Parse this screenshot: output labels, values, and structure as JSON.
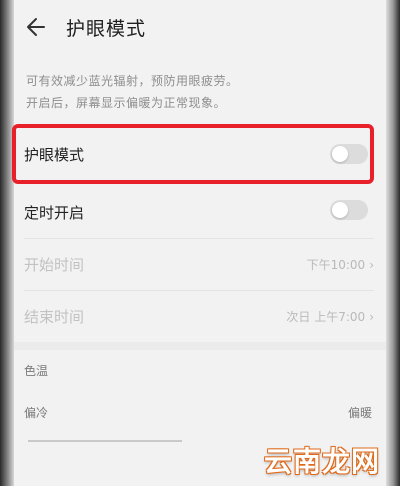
{
  "header": {
    "title": "护眼模式"
  },
  "description": {
    "line1": "可有效减少蓝光辐射，预防用眼疲劳。",
    "line2": "开启后，屏幕显示偏暖为正常现象。"
  },
  "settings": {
    "eye_comfort": {
      "label": "护眼模式",
      "enabled": false
    },
    "scheduled": {
      "label": "定时开启",
      "enabled": false
    },
    "start_time": {
      "label": "开始时间",
      "value": "下午10:00",
      "chevron": "›"
    },
    "end_time": {
      "label": "结束时间",
      "value": "次日 上午7:00",
      "chevron": "›"
    }
  },
  "color_temperature": {
    "section_label": "色温",
    "cool_label": "偏冷",
    "warm_label": "偏暖"
  },
  "watermark": "云南龙网",
  "colors": {
    "highlight_border": "#e8202a",
    "toggle_off": "#dcdcdc",
    "watermark_stroke": "#e06a1a"
  }
}
